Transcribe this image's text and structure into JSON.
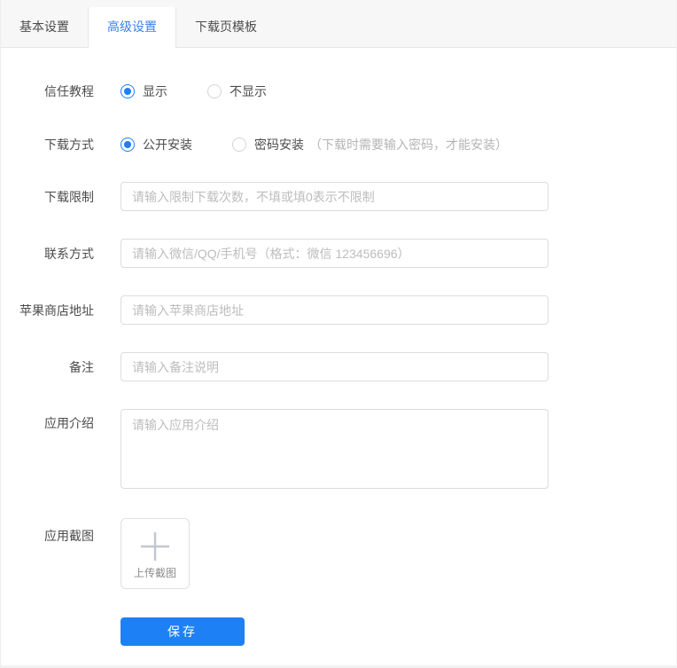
{
  "accent_color": "#1e80f5",
  "tab_active_color": "#3d7fea",
  "tabs": [
    {
      "label": "基本设置",
      "active": false
    },
    {
      "label": "高级设置",
      "active": true
    },
    {
      "label": "下载页模板",
      "active": false
    }
  ],
  "form": {
    "trust_tutorial": {
      "label": "信任教程",
      "options": [
        {
          "label": "显示",
          "selected": true
        },
        {
          "label": "不显示",
          "selected": false
        }
      ]
    },
    "download_method": {
      "label": "下载方式",
      "options": [
        {
          "label": "公开安装",
          "selected": true
        },
        {
          "label": "密码安装",
          "selected": false
        }
      ],
      "hint": "（下载时需要输入密码，才能安装）"
    },
    "download_limit": {
      "label": "下载限制",
      "value": "",
      "placeholder": "请输入限制下载次数，不填或填0表示不限制"
    },
    "contact": {
      "label": "联系方式",
      "value": "",
      "placeholder": "请输入微信/QQ/手机号（格式：微信 123456696）"
    },
    "apple_store": {
      "label": "苹果商店地址",
      "value": "",
      "placeholder": "请输入苹果商店地址"
    },
    "remark": {
      "label": "备注",
      "value": "",
      "placeholder": "请输入备注说明"
    },
    "app_intro": {
      "label": "应用介绍",
      "value": "",
      "placeholder": "请输入应用介绍"
    },
    "app_screenshot": {
      "label": "应用截图",
      "upload_label": "上传截图"
    }
  },
  "save_button_label": "保存"
}
